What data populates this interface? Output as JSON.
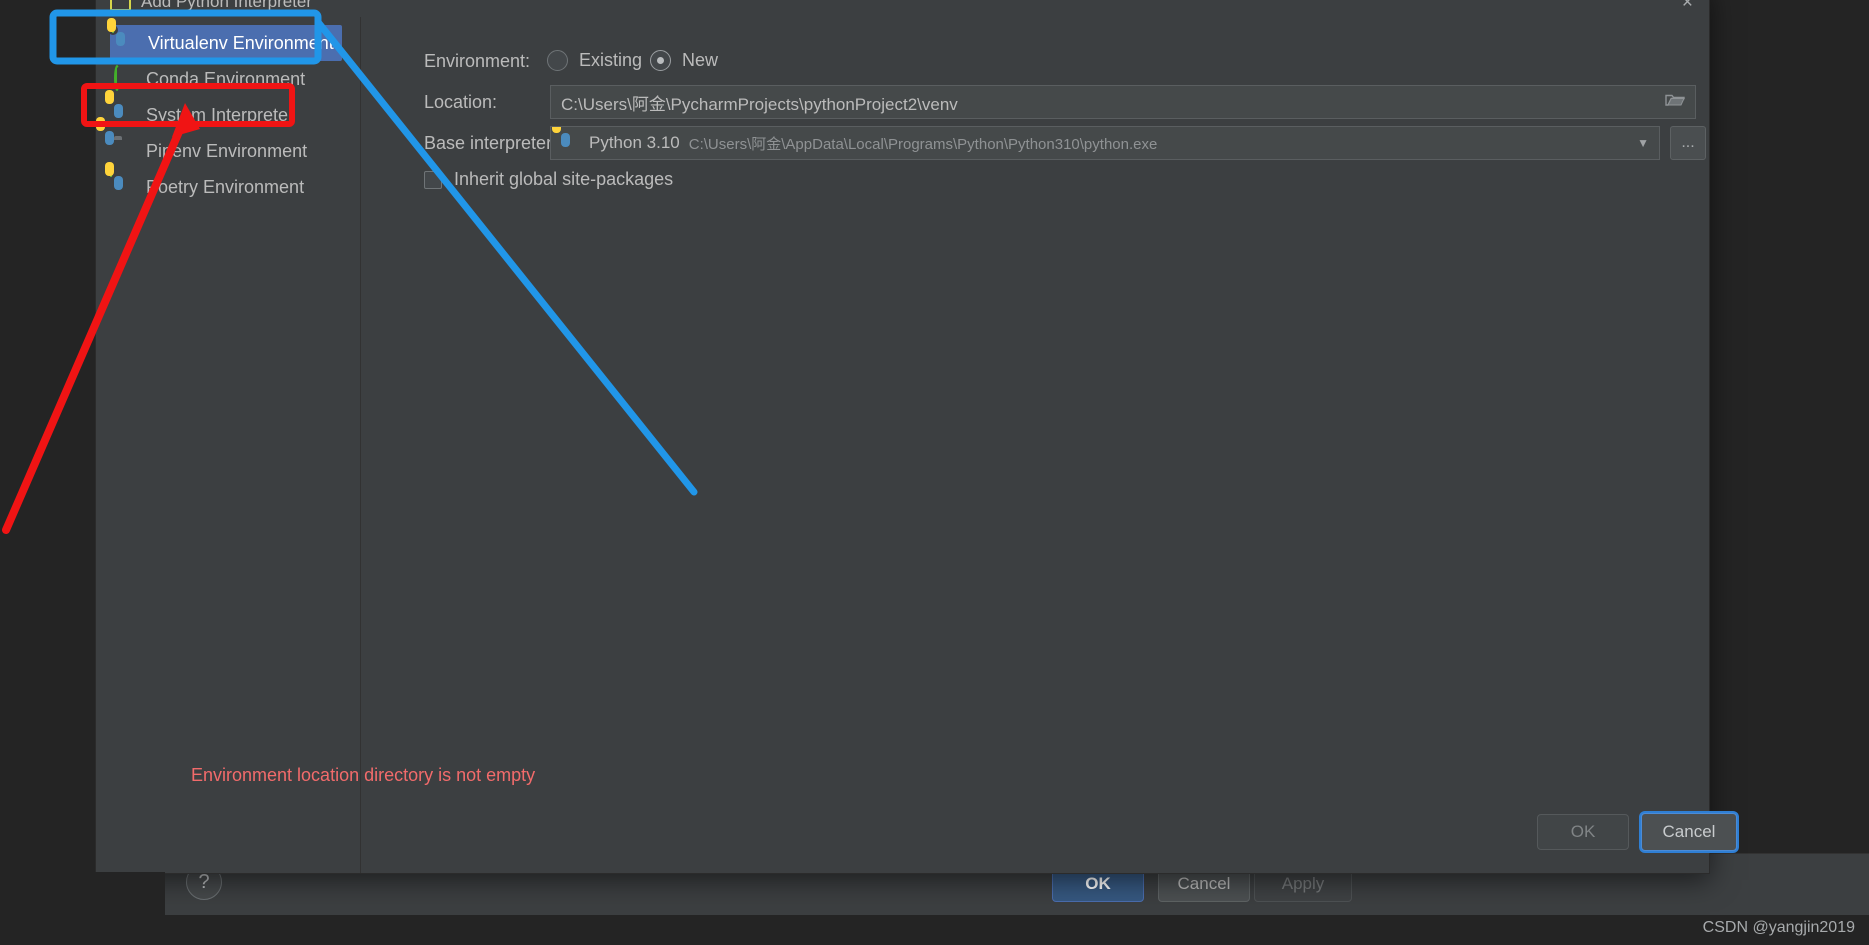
{
  "dialog": {
    "title": "Add Python Interpreter",
    "title_icon": "python-file-icon",
    "close_icon": "close-icon"
  },
  "sidebar": {
    "items": [
      {
        "label": "Virtualenv Environment",
        "icon": "python-venv-icon",
        "selected": true
      },
      {
        "label": "Conda Environment",
        "icon": "conda-ring-icon",
        "selected": false
      },
      {
        "label": "System Interpreter",
        "icon": "python-icon",
        "selected": false
      },
      {
        "label": "Pipenv Environment",
        "icon": "pipenv-folder-icon",
        "selected": false
      },
      {
        "label": "Poetry Environment",
        "icon": "poetry-python-icon",
        "selected": false
      }
    ]
  },
  "form": {
    "environment_label": "Environment:",
    "radio_existing": "Existing",
    "radio_new": "New",
    "selected_environment": "New",
    "location_label": "Location:",
    "location_value": "C:\\Users\\阿金\\PycharmProjects\\pythonProject2\\venv",
    "location_browse_icon": "folder-icon",
    "base_interpreter_label": "Base interpreter:",
    "base_interpreter_name": "Python 3.10",
    "base_interpreter_path": "C:\\Users\\阿金\\AppData\\Local\\Programs\\Python\\Python310\\python.exe",
    "base_interpreter_icon": "python-icon",
    "dropdown_icon": "chevron-down-icon",
    "more_button_label": "...",
    "inherit_label": "Inherit global site-packages",
    "inherit_checked": false
  },
  "status": {
    "error_message": "Environment location directory is not empty",
    "error_color": "#f26b6b"
  },
  "dialog_buttons": {
    "ok": "OK",
    "cancel": "Cancel",
    "ok_enabled": false,
    "cancel_focused": true
  },
  "background_dialog": {
    "help_icon": "question-mark-icon",
    "ok": "OK",
    "cancel": "Cancel",
    "apply": "Apply",
    "apply_enabled": false,
    "ok_color": "#365880"
  },
  "annotations": {
    "blue_color": "#2196e8",
    "red_color": "#f01414",
    "blue_highlight_target": "Virtualenv Environment",
    "red_highlight_target": "System Interpreter"
  },
  "watermark": "CSDN @yangjin2019"
}
